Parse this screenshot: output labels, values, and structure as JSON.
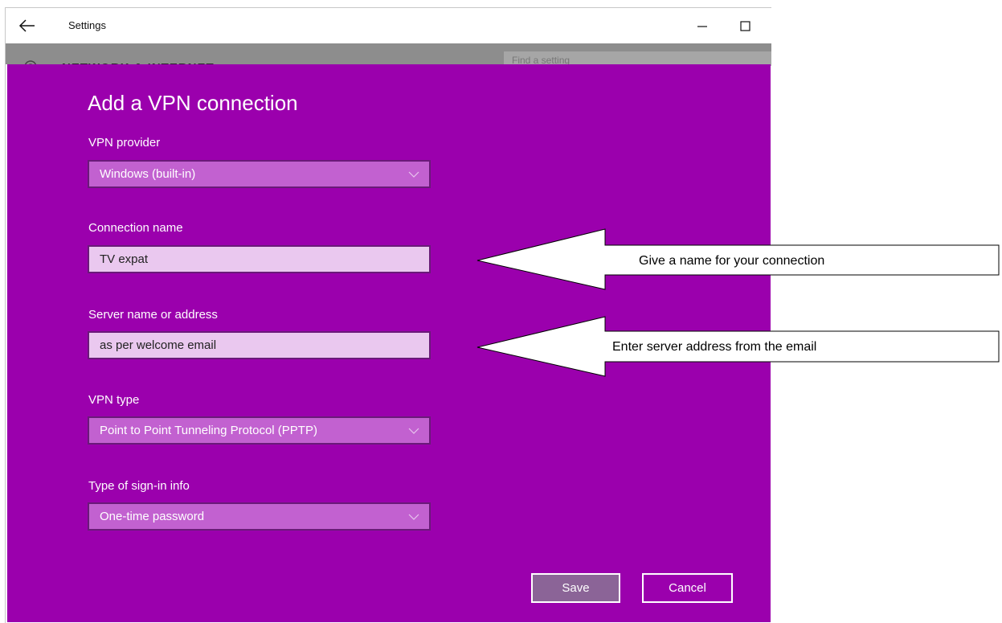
{
  "window": {
    "title": "Settings",
    "background_heading": "NETWORK & INTERNET",
    "search_placeholder": "Find a setting"
  },
  "dialog": {
    "title": "Add a VPN connection",
    "accent_color": "#9b00ad",
    "fields": {
      "vpn_provider": {
        "label": "VPN provider",
        "value": "Windows (built-in)"
      },
      "connection_name": {
        "label": "Connection name",
        "value": "TV expat"
      },
      "server": {
        "label": "Server name or address",
        "value": "as per welcome email"
      },
      "vpn_type": {
        "label": "VPN type",
        "value": "Point to Point Tunneling Protocol (PPTP)"
      },
      "sign_in_type": {
        "label": "Type of sign-in info",
        "value": "One-time password"
      }
    },
    "buttons": {
      "save": "Save",
      "cancel": "Cancel"
    }
  },
  "annotations": {
    "connection_name_hint": "Give a name for your connection",
    "server_hint": "Enter server address from the email"
  },
  "icons": [
    "back-arrow-icon",
    "minimize-icon",
    "maximize-icon",
    "gear-icon",
    "chevron-down-icon"
  ]
}
